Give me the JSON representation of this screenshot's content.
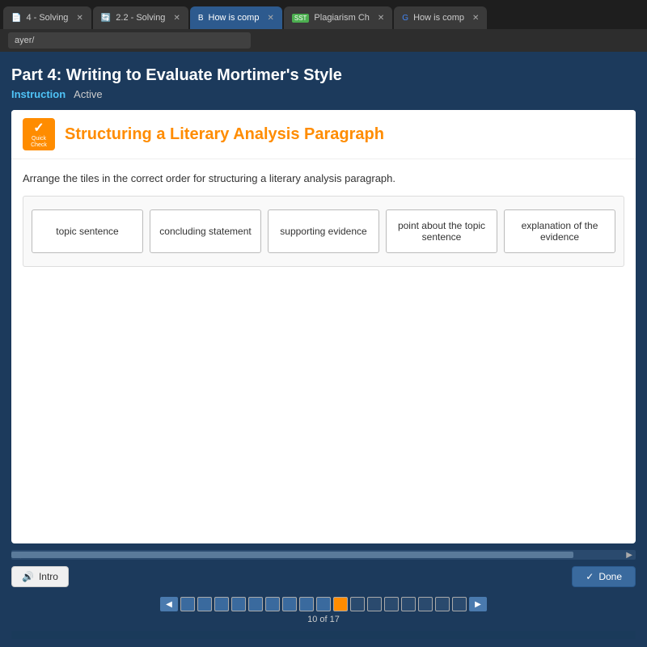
{
  "browser": {
    "tabs": [
      {
        "id": 1,
        "label": "4 - Solving",
        "icon": "📄",
        "active": false
      },
      {
        "id": 2,
        "label": "2.2 - Solving",
        "icon": "🔄",
        "active": false
      },
      {
        "id": 3,
        "label": "How is comp",
        "icon": "B",
        "active": true
      },
      {
        "id": 4,
        "label": "Plagiarism Ch",
        "icon": "SST",
        "active": false
      },
      {
        "id": 5,
        "label": "How is comp",
        "icon": "G",
        "active": false
      }
    ],
    "address": "ayer/"
  },
  "page": {
    "title": "Part 4: Writing to Evaluate Mortimer's Style",
    "instruction_label": "Instruction",
    "status_label": "Active",
    "card": {
      "header_title": "Structuring a Literary Analysis Paragraph",
      "quick_check_label": "Quick\nCheck",
      "instruction_text": "Arrange the tiles in the correct order for structuring a literary analysis paragraph.",
      "tiles": [
        {
          "id": 1,
          "label": "topic sentence"
        },
        {
          "id": 2,
          "label": "concluding statement"
        },
        {
          "id": 3,
          "label": "supporting evidence"
        },
        {
          "id": 4,
          "label": "point about the topic sentence"
        },
        {
          "id": 5,
          "label": "explanation of the evidence"
        }
      ]
    },
    "controls": {
      "intro_button": "Intro",
      "done_button": "Done"
    },
    "pagination": {
      "current": 10,
      "total": 17,
      "counter_text": "10 of 17"
    }
  }
}
